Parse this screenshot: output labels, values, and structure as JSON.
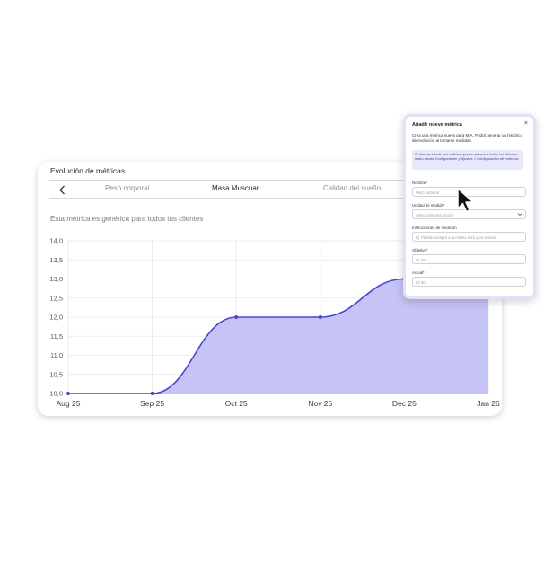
{
  "card": {
    "title": "Evolución de métricas",
    "subtitle": "Esta métrica es genérica para todos tus clientes",
    "tabs": [
      {
        "label": "Peso corporal",
        "active": false
      },
      {
        "label": "Masa Muscuar",
        "active": true
      },
      {
        "label": "Calidad del sueño",
        "active": false
      }
    ]
  },
  "chart_data": {
    "type": "area",
    "x": [
      "Aug 25",
      "Sep 25",
      "Oct 25",
      "Nov 25",
      "Dec 25",
      "Jan 26"
    ],
    "y_ticks": [
      "14,0",
      "13,5",
      "13,0",
      "12,5",
      "12,0",
      "11,5",
      "11,0",
      "10,5",
      "10,0"
    ],
    "ylim": [
      10.0,
      14.0
    ],
    "series": [
      {
        "values": [
          10.0,
          10.0,
          12.0,
          12.0,
          13.0,
          13.9
        ]
      }
    ],
    "grid": true,
    "colors": {
      "line": "#4b44d4",
      "fill": "#c6c3f6"
    }
  },
  "modal": {
    "title": "Añadir nueva métrica",
    "close": "×",
    "description": "Crea una métrica nueva para MIA. Podrá generar un histórico de evolución al tomarse medidas.",
    "info_text": "Si deseas añadir una métrica que se aplique a todos los clientes, hazlo desde",
    "info_link": "Configuración y Ajustes > Configuración de métricas",
    "fields": {
      "name": {
        "label": "Nombre",
        "required": "*",
        "placeholder": "Peso corporal"
      },
      "unit": {
        "label": "Unidad de medida",
        "required": "*",
        "placeholder": "Selecciona una opción"
      },
      "instructions": {
        "label": "Instrucciones de medición",
        "placeholder": "Ej: Pésate siempre a la misma hora y en ayunas"
      },
      "goal": {
        "label": "Objetivo",
        "required": "*",
        "placeholder": "Ej: 65"
      },
      "current": {
        "label": "Actual",
        "required": "*",
        "placeholder": "Ej: 60"
      }
    }
  }
}
